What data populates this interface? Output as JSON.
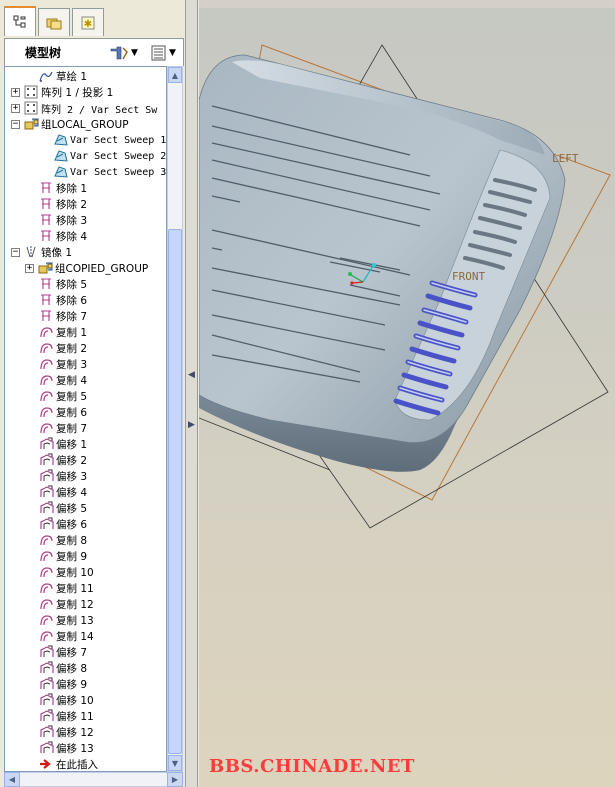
{
  "panel": {
    "title": "模型树",
    "tabs": [
      {
        "name": "model-tree-tab",
        "icon": "tree-icon",
        "active": true
      },
      {
        "name": "folder-tab",
        "icon": "folder-icon",
        "active": false
      },
      {
        "name": "favorites-tab",
        "icon": "star-icon",
        "active": false
      }
    ]
  },
  "tree": {
    "items": [
      {
        "label": "草绘 1",
        "icon": "sketch",
        "indent": 1,
        "expand": ""
      },
      {
        "label": "阵列 1 / 投影 1",
        "icon": "pattern",
        "indent": 0,
        "expand": "+"
      },
      {
        "label": "阵列 2 / Var Sect Sw",
        "icon": "pattern",
        "indent": 0,
        "expand": "+"
      },
      {
        "label": "组LOCAL_GROUP",
        "icon": "group",
        "indent": 0,
        "expand": "-"
      },
      {
        "label": "Var Sect Sweep 1",
        "icon": "sweep",
        "indent": 2,
        "expand": ""
      },
      {
        "label": "Var Sect Sweep 2",
        "icon": "sweep",
        "indent": 2,
        "expand": ""
      },
      {
        "label": "Var Sect Sweep 3",
        "icon": "sweep",
        "indent": 2,
        "expand": ""
      },
      {
        "label": "移除 1",
        "icon": "remove",
        "indent": 1,
        "expand": ""
      },
      {
        "label": "移除 2",
        "icon": "remove",
        "indent": 1,
        "expand": ""
      },
      {
        "label": "移除 3",
        "icon": "remove",
        "indent": 1,
        "expand": ""
      },
      {
        "label": "移除 4",
        "icon": "remove",
        "indent": 1,
        "expand": ""
      },
      {
        "label": "镜像 1",
        "icon": "mirror",
        "indent": 0,
        "expand": "-"
      },
      {
        "label": "组COPIED_GROUP",
        "icon": "group",
        "indent": 2,
        "expand": "+"
      },
      {
        "label": "移除 5",
        "icon": "remove",
        "indent": 1,
        "expand": ""
      },
      {
        "label": "移除 6",
        "icon": "remove",
        "indent": 1,
        "expand": ""
      },
      {
        "label": "移除 7",
        "icon": "remove",
        "indent": 1,
        "expand": ""
      },
      {
        "label": "复制 1",
        "icon": "copy",
        "indent": 1,
        "expand": ""
      },
      {
        "label": "复制 2",
        "icon": "copy",
        "indent": 1,
        "expand": ""
      },
      {
        "label": "复制 3",
        "icon": "copy",
        "indent": 1,
        "expand": ""
      },
      {
        "label": "复制 4",
        "icon": "copy",
        "indent": 1,
        "expand": ""
      },
      {
        "label": "复制 5",
        "icon": "copy",
        "indent": 1,
        "expand": ""
      },
      {
        "label": "复制 6",
        "icon": "copy",
        "indent": 1,
        "expand": ""
      },
      {
        "label": "复制 7",
        "icon": "copy",
        "indent": 1,
        "expand": ""
      },
      {
        "label": "偏移 1",
        "icon": "offset",
        "indent": 1,
        "expand": ""
      },
      {
        "label": "偏移 2",
        "icon": "offset",
        "indent": 1,
        "expand": ""
      },
      {
        "label": "偏移 3",
        "icon": "offset",
        "indent": 1,
        "expand": ""
      },
      {
        "label": "偏移 4",
        "icon": "offset",
        "indent": 1,
        "expand": ""
      },
      {
        "label": "偏移 5",
        "icon": "offset",
        "indent": 1,
        "expand": ""
      },
      {
        "label": "偏移 6",
        "icon": "offset",
        "indent": 1,
        "expand": ""
      },
      {
        "label": "复制 8",
        "icon": "copy",
        "indent": 1,
        "expand": ""
      },
      {
        "label": "复制 9",
        "icon": "copy",
        "indent": 1,
        "expand": ""
      },
      {
        "label": "复制 10",
        "icon": "copy",
        "indent": 1,
        "expand": ""
      },
      {
        "label": "复制 11",
        "icon": "copy",
        "indent": 1,
        "expand": ""
      },
      {
        "label": "复制 12",
        "icon": "copy",
        "indent": 1,
        "expand": ""
      },
      {
        "label": "复制 13",
        "icon": "copy",
        "indent": 1,
        "expand": ""
      },
      {
        "label": "复制 14",
        "icon": "copy",
        "indent": 1,
        "expand": ""
      },
      {
        "label": "偏移 7",
        "icon": "offset",
        "indent": 1,
        "expand": ""
      },
      {
        "label": "偏移 8",
        "icon": "offset",
        "indent": 1,
        "expand": ""
      },
      {
        "label": "偏移 9",
        "icon": "offset",
        "indent": 1,
        "expand": ""
      },
      {
        "label": "偏移 10",
        "icon": "offset",
        "indent": 1,
        "expand": ""
      },
      {
        "label": "偏移 11",
        "icon": "offset",
        "indent": 1,
        "expand": ""
      },
      {
        "label": "偏移 12",
        "icon": "offset",
        "indent": 1,
        "expand": ""
      },
      {
        "label": "偏移 13",
        "icon": "offset",
        "indent": 1,
        "expand": ""
      },
      {
        "label": "在此插入",
        "icon": "insert",
        "indent": 1,
        "expand": ""
      }
    ]
  },
  "viewport": {
    "plane_labels": {
      "left": "LEFT",
      "front": "FRONT"
    },
    "watermark": "BBS.CHINADE.NET"
  },
  "colors": {
    "accent_tab": "#e68b2c",
    "icon_pink": "#b0408c",
    "datum_plane": "#b8763a",
    "model_surface": "#b6c2cc",
    "watermark": "#ff3b3b"
  }
}
